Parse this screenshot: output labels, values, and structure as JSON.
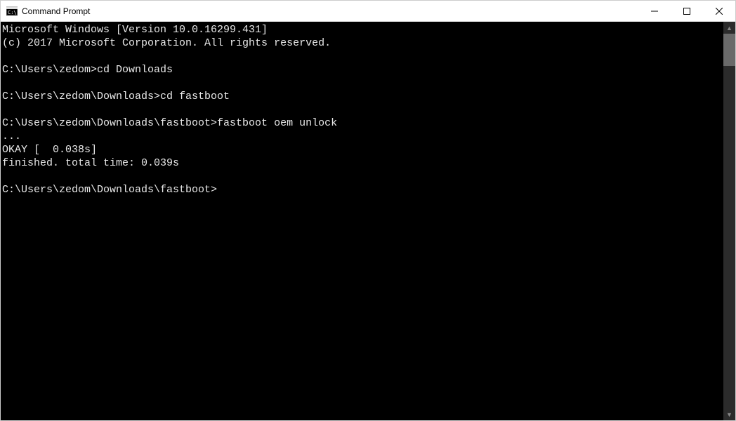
{
  "window": {
    "title": "Command Prompt"
  },
  "terminal": {
    "lines": [
      "Microsoft Windows [Version 10.0.16299.431]",
      "(c) 2017 Microsoft Corporation. All rights reserved.",
      "",
      "C:\\Users\\zedom>cd Downloads",
      "",
      "C:\\Users\\zedom\\Downloads>cd fastboot",
      "",
      "C:\\Users\\zedom\\Downloads\\fastboot>fastboot oem unlock",
      "...",
      "OKAY [  0.038s]",
      "finished. total time: 0.039s",
      "",
      "C:\\Users\\zedom\\Downloads\\fastboot>"
    ]
  }
}
